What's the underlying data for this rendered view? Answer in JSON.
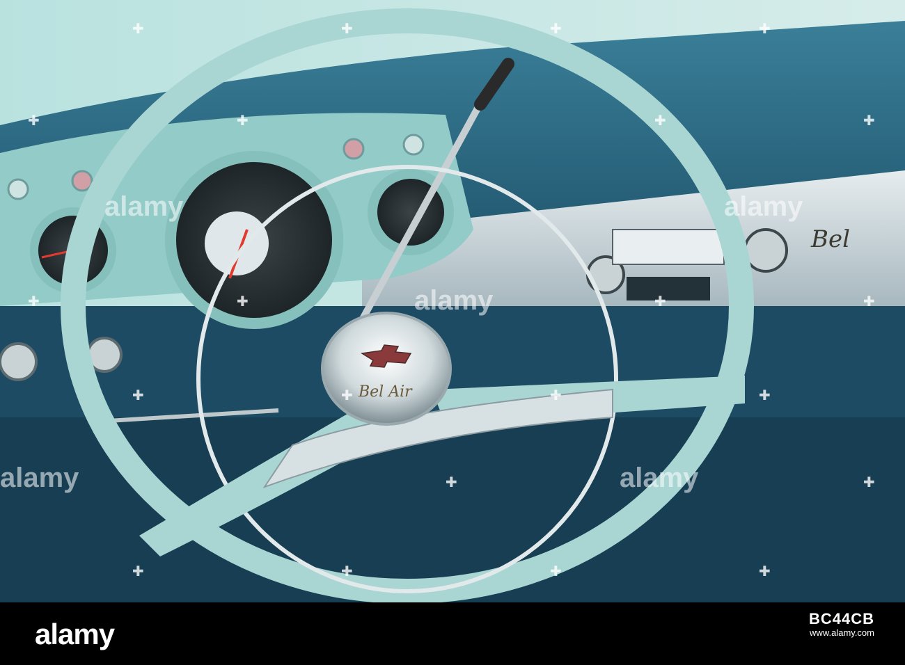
{
  "photo": {
    "alt": "",
    "colors": {
      "wheel": "#a9d6d3",
      "dash": "#2f6f8a",
      "gauges": "#9ad0cc",
      "chrome": "#dfe7ea",
      "panel": "#1d4b63"
    },
    "badge_text": "Bel Air",
    "dash_script": "Bel"
  },
  "watermark": {
    "text": "alamy",
    "cross_glyph": "✚"
  },
  "footer": {
    "brand": "alamy",
    "image_code": "BC44CB",
    "site": "www.alamy.com"
  }
}
